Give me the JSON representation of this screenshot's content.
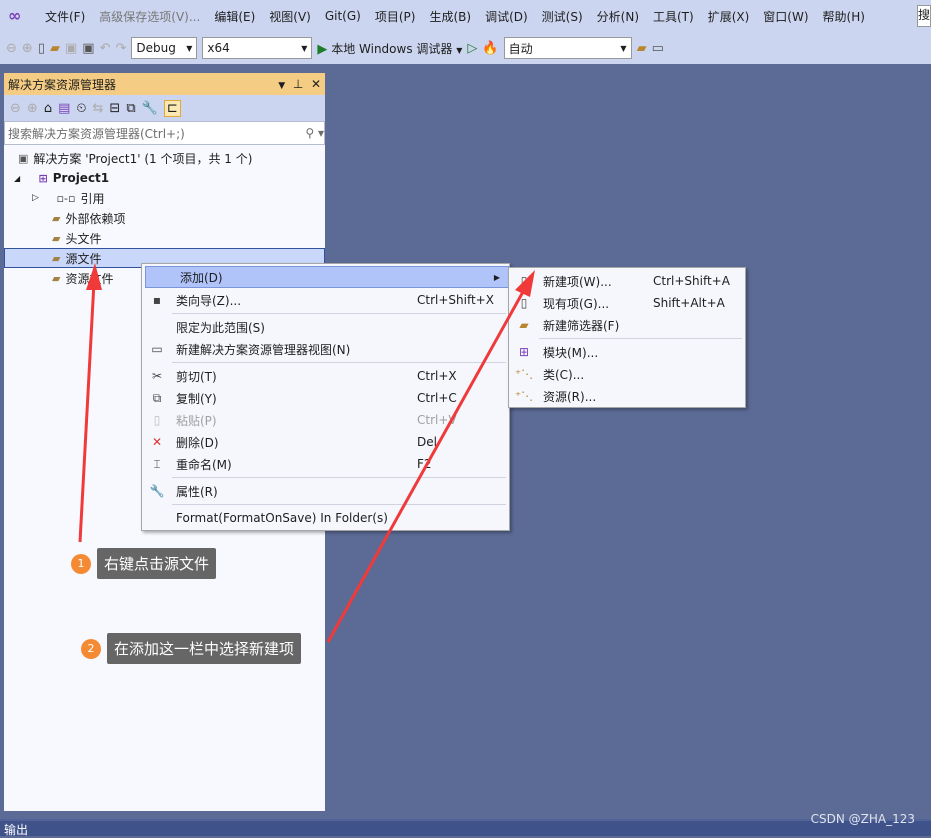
{
  "menubar": {
    "items": [
      "文件(F)",
      "高级保存选项(V)...",
      "编辑(E)",
      "视图(V)",
      "Git(G)",
      "项目(P)",
      "生成(B)",
      "调试(D)",
      "测试(S)",
      "分析(N)",
      "工具(T)",
      "扩展(X)",
      "窗口(W)",
      "帮助(H)"
    ],
    "search_stub": "搜"
  },
  "toolbar": {
    "config": "Debug",
    "platform": "x64",
    "run_label": "本地 Windows 调试器",
    "target": "自动"
  },
  "solution_explorer": {
    "title": "解决方案资源管理器",
    "search_placeholder": "搜索解决方案资源管理器(Ctrl+;)",
    "tree": [
      "解决方案 'Project1' (1 个项目，共 1 个)",
      "Project1",
      "引用",
      "外部依赖项",
      "头文件",
      "源文件",
      "资源文件"
    ]
  },
  "context_menu": {
    "items": [
      {
        "label": "添加(D)",
        "shortcut": "",
        "icon": ""
      },
      {
        "label": "类向导(Z)...",
        "shortcut": "Ctrl+Shift+X",
        "icon": "class-wizard-icon"
      },
      {
        "label": "限定为此范围(S)",
        "shortcut": "",
        "icon": ""
      },
      {
        "label": "新建解决方案资源管理器视图(N)",
        "shortcut": "",
        "icon": "new-view-icon"
      },
      {
        "label": "剪切(T)",
        "shortcut": "Ctrl+X",
        "icon": "scissors-icon"
      },
      {
        "label": "复制(Y)",
        "shortcut": "Ctrl+C",
        "icon": "copy-icon"
      },
      {
        "label": "粘贴(P)",
        "shortcut": "Ctrl+V",
        "icon": "paste-icon"
      },
      {
        "label": "删除(D)",
        "shortcut": "Del",
        "icon": "delete-icon"
      },
      {
        "label": "重命名(M)",
        "shortcut": "F2",
        "icon": "rename-icon"
      },
      {
        "label": "属性(R)",
        "shortcut": "",
        "icon": "wrench-icon"
      },
      {
        "label": "Format(FormatOnSave) In Folder(s)",
        "shortcut": "",
        "icon": ""
      }
    ]
  },
  "submenu": {
    "items": [
      {
        "label": "新建项(W)...",
        "shortcut": "Ctrl+Shift+A"
      },
      {
        "label": "现有项(G)...",
        "shortcut": "Shift+Alt+A"
      },
      {
        "label": "新建筛选器(F)",
        "shortcut": ""
      },
      {
        "label": "模块(M)...",
        "shortcut": ""
      },
      {
        "label": "类(C)...",
        "shortcut": ""
      },
      {
        "label": "资源(R)...",
        "shortcut": ""
      }
    ]
  },
  "callouts": [
    {
      "num": "1",
      "text": "右键点击源文件"
    },
    {
      "num": "2",
      "text": "在添加这一栏中选择新建项"
    }
  ],
  "bottom": {
    "label": "输出"
  },
  "watermark": "CSDN @ZHA_123",
  "colors": {
    "accent": "#f58a34",
    "arrow": "#f03a3a",
    "panel_header": "#f5cc84",
    "background": "#5c6b96"
  }
}
